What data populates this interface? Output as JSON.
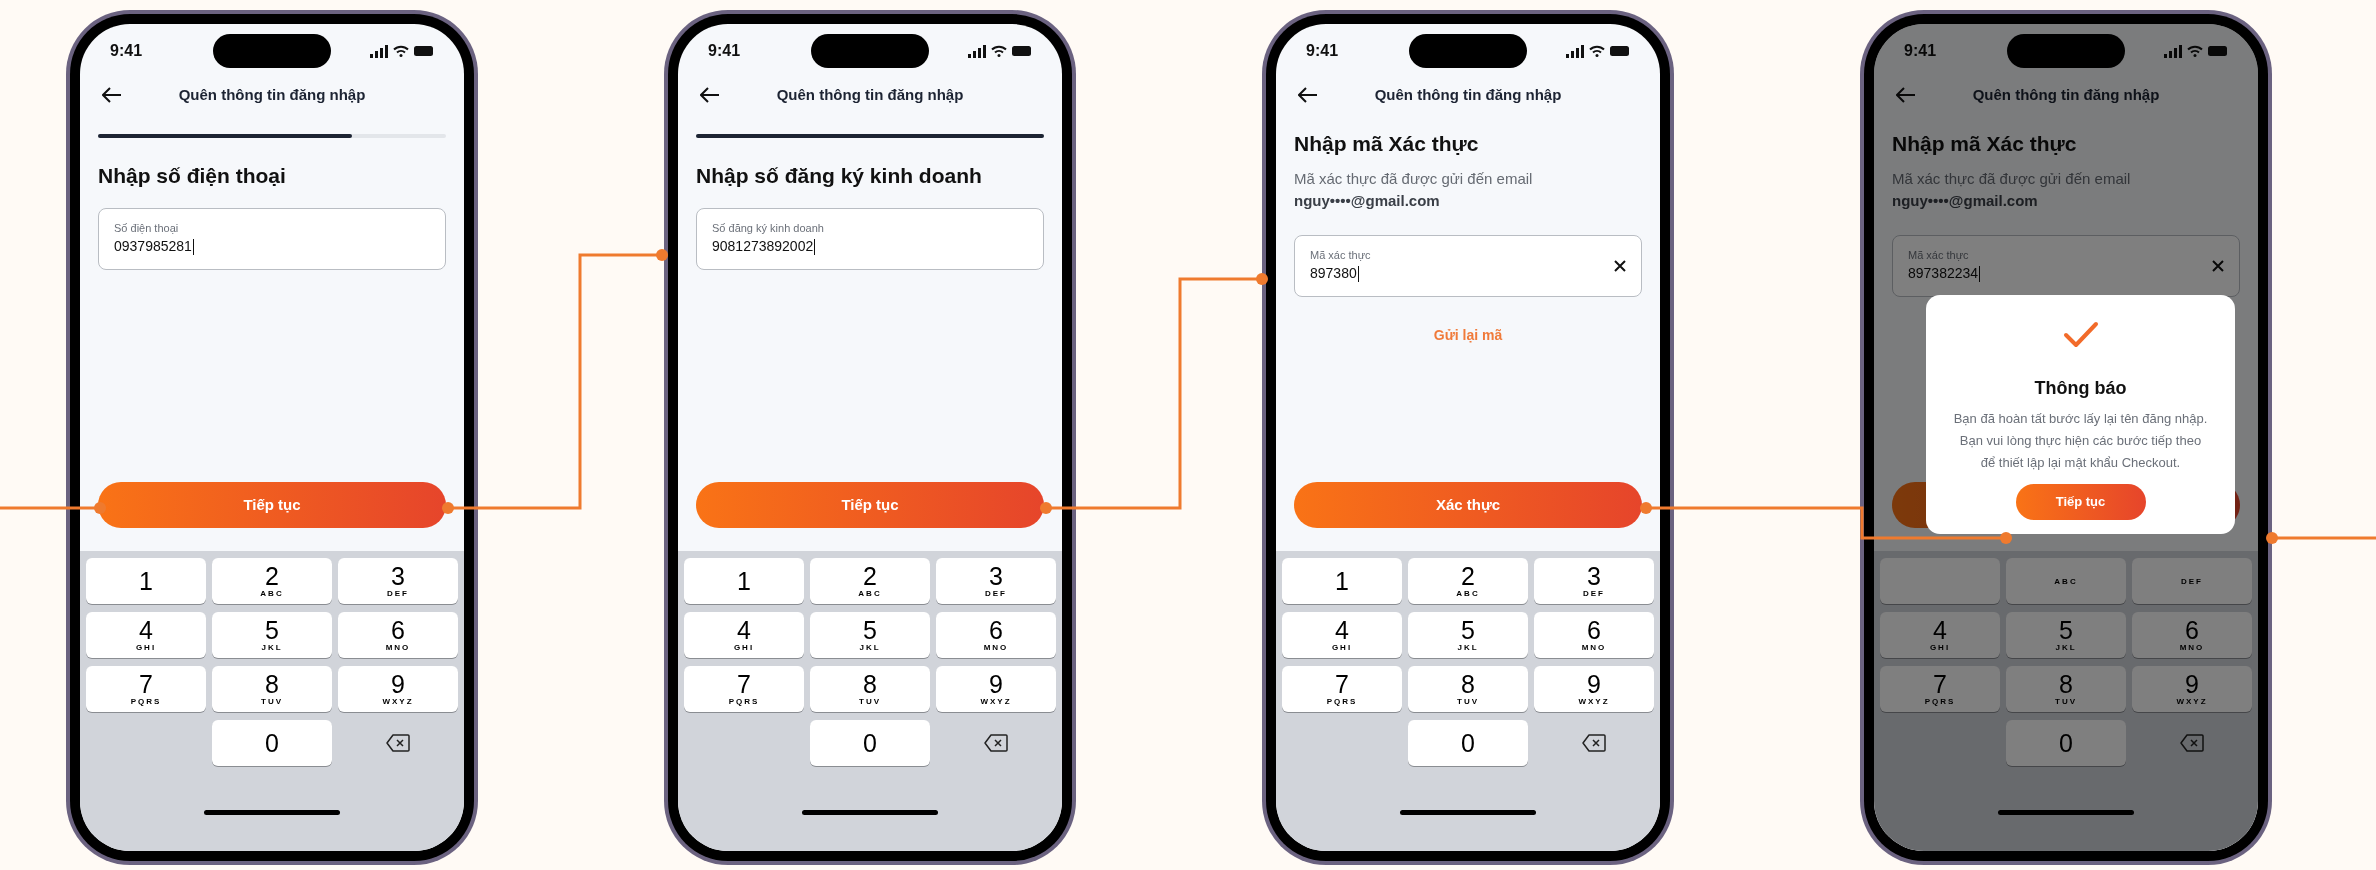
{
  "phones": [
    {
      "time": "9:41",
      "header": "Quên thông tin đăng nhập",
      "progress": {
        "level": 0.73
      },
      "heading": "Nhập số điện thoại",
      "field": {
        "label": "Số điện thoại",
        "value": "0937985281",
        "clearable": false
      },
      "button": {
        "label": "Tiếp tục"
      },
      "dimmed": false,
      "keypad": [
        {
          "kind": "digit",
          "digit": "1"
        },
        {
          "kind": "digit",
          "digit": "2",
          "letters": "ABC"
        },
        {
          "kind": "digit",
          "digit": "3",
          "letters": "DEF"
        },
        {
          "kind": "digit",
          "digit": "4",
          "letters": "GHI"
        },
        {
          "kind": "digit",
          "digit": "5",
          "letters": "JKL"
        },
        {
          "kind": "digit",
          "digit": "6",
          "letters": "MNO"
        },
        {
          "kind": "digit",
          "digit": "7",
          "letters": "PQRS"
        },
        {
          "kind": "digit",
          "digit": "8",
          "letters": "TUV"
        },
        {
          "kind": "digit",
          "digit": "9",
          "letters": "WXYZ"
        },
        {
          "kind": "blank"
        },
        {
          "kind": "digit",
          "digit": "0"
        },
        {
          "kind": "delete"
        }
      ]
    },
    {
      "time": "9:41",
      "header": "Quên thông tin đăng nhập",
      "progress": {
        "level": 1
      },
      "heading": "Nhập số đăng ký kinh doanh",
      "field": {
        "label": "Số đăng ký kinh doanh",
        "value": "9081273892002",
        "clearable": false
      },
      "button": {
        "label": "Tiếp tục"
      },
      "dimmed": false,
      "keypad": [
        {
          "kind": "digit",
          "digit": "1"
        },
        {
          "kind": "digit",
          "digit": "2",
          "letters": "ABC"
        },
        {
          "kind": "digit",
          "digit": "3",
          "letters": "DEF"
        },
        {
          "kind": "digit",
          "digit": "4",
          "letters": "GHI"
        },
        {
          "kind": "digit",
          "digit": "5",
          "letters": "JKL"
        },
        {
          "kind": "digit",
          "digit": "6",
          "letters": "MNO"
        },
        {
          "kind": "digit",
          "digit": "7",
          "letters": "PQRS"
        },
        {
          "kind": "digit",
          "digit": "8",
          "letters": "TUV"
        },
        {
          "kind": "digit",
          "digit": "9",
          "letters": "WXYZ"
        },
        {
          "kind": "blank"
        },
        {
          "kind": "digit",
          "digit": "0"
        },
        {
          "kind": "delete"
        }
      ]
    },
    {
      "time": "9:41",
      "header": "Quên thông tin đăng nhập",
      "heading": "Nhập mã Xác thực",
      "description": "Mã xác thực đã được gửi đến email",
      "email": "nguy••••@gmail.com",
      "field": {
        "label": "Mã xác thực",
        "value": "897380",
        "clearable": true
      },
      "link": "Gửi lại mã",
      "button": {
        "label": "Xác thực"
      },
      "dimmed": false,
      "keypad": [
        {
          "kind": "digit",
          "digit": "1"
        },
        {
          "kind": "digit",
          "digit": "2",
          "letters": "ABC"
        },
        {
          "kind": "digit",
          "digit": "3",
          "letters": "DEF"
        },
        {
          "kind": "digit",
          "digit": "4",
          "letters": "GHI"
        },
        {
          "kind": "digit",
          "digit": "5",
          "letters": "JKL"
        },
        {
          "kind": "digit",
          "digit": "6",
          "letters": "MNO"
        },
        {
          "kind": "digit",
          "digit": "7",
          "letters": "PQRS"
        },
        {
          "kind": "digit",
          "digit": "8",
          "letters": "TUV"
        },
        {
          "kind": "digit",
          "digit": "9",
          "letters": "WXYZ"
        },
        {
          "kind": "blank"
        },
        {
          "kind": "digit",
          "digit": "0"
        },
        {
          "kind": "delete"
        }
      ]
    },
    {
      "time": "9:41",
      "header": "Quên thông tin đăng nhập",
      "heading": "Nhập mã Xác thực",
      "description": "Mã xác thực đã được gửi đến email",
      "email": "nguy••••@gmail.com",
      "field": {
        "label": "Mã xác thực",
        "value": "897382234",
        "clearable": true
      },
      "dimmed": true,
      "keypad": [
        {
          "kind": "digit"
        },
        {
          "kind": "digit",
          "letters": "ABC"
        },
        {
          "kind": "digit",
          "letters": "DEF"
        },
        {
          "kind": "digit",
          "digit": "4",
          "letters": "GHI"
        },
        {
          "kind": "digit",
          "digit": "5",
          "letters": "JKL"
        },
        {
          "kind": "digit",
          "digit": "6",
          "letters": "MNO"
        },
        {
          "kind": "digit",
          "digit": "7",
          "letters": "PQRS"
        },
        {
          "kind": "digit",
          "digit": "8",
          "letters": "TUV"
        },
        {
          "kind": "digit",
          "digit": "9",
          "letters": "WXYZ"
        },
        {
          "kind": "blank"
        },
        {
          "kind": "digit",
          "digit": "0"
        },
        {
          "kind": "delete"
        }
      ],
      "dialog": {
        "title": "Thông báo",
        "message": "Bạn đã hoàn tất bước lấy lại tên đăng nhập. Bạn vui lòng thực hiện các bước tiếp theo để thiết lập lại mật khẩu Checkout.",
        "button": "Tiếp tục"
      }
    }
  ]
}
